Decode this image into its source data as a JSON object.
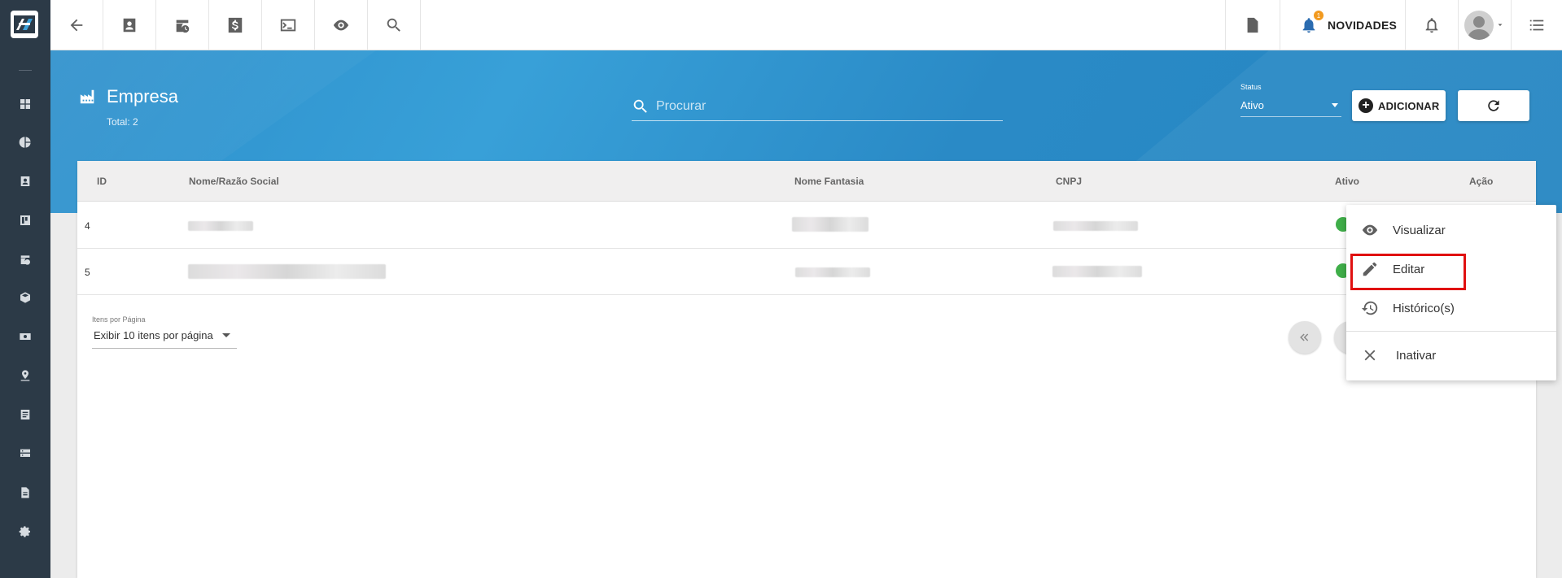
{
  "topbar": {
    "novidades_label": "NOVIDADES",
    "notification_badge": "1"
  },
  "header": {
    "title": "Empresa",
    "total": "Total: 2"
  },
  "search": {
    "placeholder": "Procurar"
  },
  "status_filter": {
    "label": "Status",
    "value": "Ativo"
  },
  "actions": {
    "add_label": "ADICIONAR"
  },
  "table": {
    "columns": [
      "ID",
      "Nome/Razão Social",
      "Nome Fantasia",
      "CNPJ",
      "Ativo",
      "Ação"
    ],
    "rows": [
      {
        "id": "4",
        "ativo": true
      },
      {
        "id": "5",
        "ativo": true
      }
    ]
  },
  "pagination": {
    "per_page_label": "Itens por Página",
    "per_page_value": "Exibir 10 itens por página"
  },
  "action_menu": {
    "items": [
      {
        "label": "Visualizar",
        "icon": "eye-icon"
      },
      {
        "label": "Editar",
        "icon": "pencil-icon"
      },
      {
        "label": "Histórico(s)",
        "icon": "history-icon"
      },
      {
        "label": "Inativar",
        "icon": "close-icon"
      }
    ],
    "highlighted_item": "Editar"
  },
  "colors": {
    "sidebar": "#2c3a47",
    "banner": "#2d8fcb",
    "active_check": "#3fae49",
    "badge": "#f29a1f",
    "highlight": "#e01010"
  }
}
